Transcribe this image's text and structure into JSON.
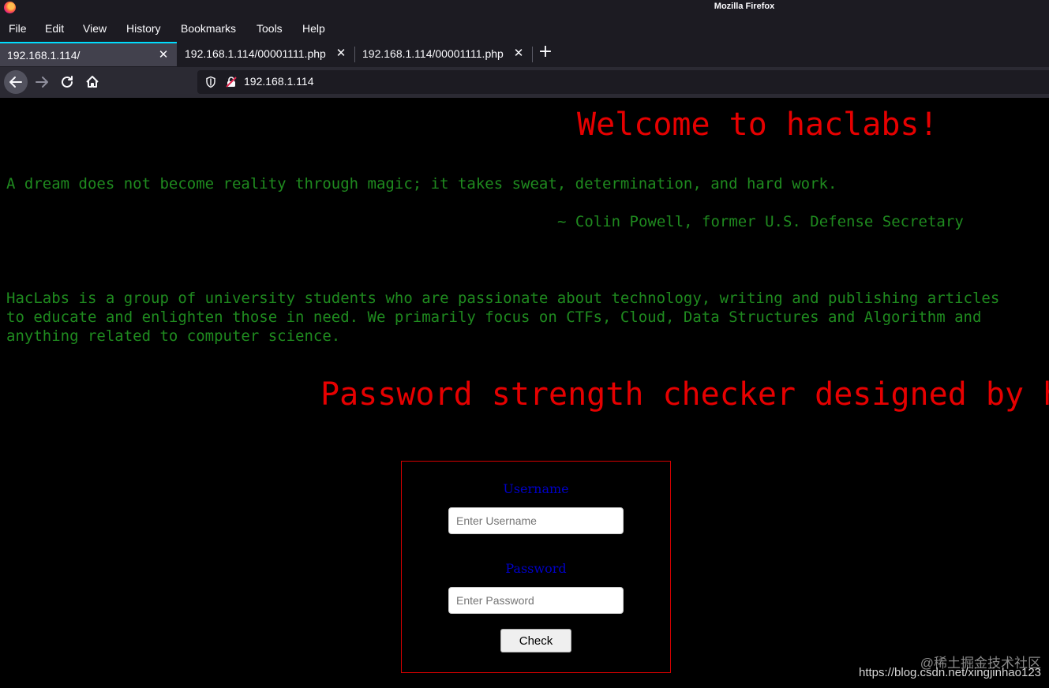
{
  "window": {
    "title": "Mozilla Firefox"
  },
  "menu": [
    "File",
    "Edit",
    "View",
    "History",
    "Bookmarks",
    "Tools",
    "Help"
  ],
  "tabs": [
    {
      "label": "192.168.1.114/"
    },
    {
      "label": "192.168.1.114/00001111.php"
    },
    {
      "label": "192.168.1.114/00001111.php"
    }
  ],
  "tab_close_glyph": "✕",
  "newtab_glyph": "+",
  "nav": {
    "url": "192.168.1.114"
  },
  "page": {
    "welcome": "Welcome to haclabs!",
    "quote": "A dream does not become reality through magic; it takes sweat, determination, and hard work.",
    "author": "~ Colin Powell, former U.S. Defense Secretary",
    "about_lines": [
      "HacLabs is a group of university students who are passionate about technology, writing and publishing articles",
      "to educate and enlighten those in need. We primarily focus on CTFs, Cloud, Data Structures and Algorithm and",
      "anything related to computer science."
    ],
    "checker_heading": "Password strength checker designed by h",
    "form": {
      "username_label": "Username",
      "username_placeholder": "Enter Username",
      "password_label": "Password",
      "password_placeholder": "Enter Password",
      "check_label": "Check"
    }
  },
  "watermark": {
    "line1": "@稀土掘金技术社区",
    "line2": "https://blog.csdn.net/xingjinhao123"
  },
  "colors": {
    "heading_red": "#e60000",
    "text_green": "#1f8a1f",
    "label_blue": "#0000c8",
    "tab_accent": "#00ddff"
  }
}
